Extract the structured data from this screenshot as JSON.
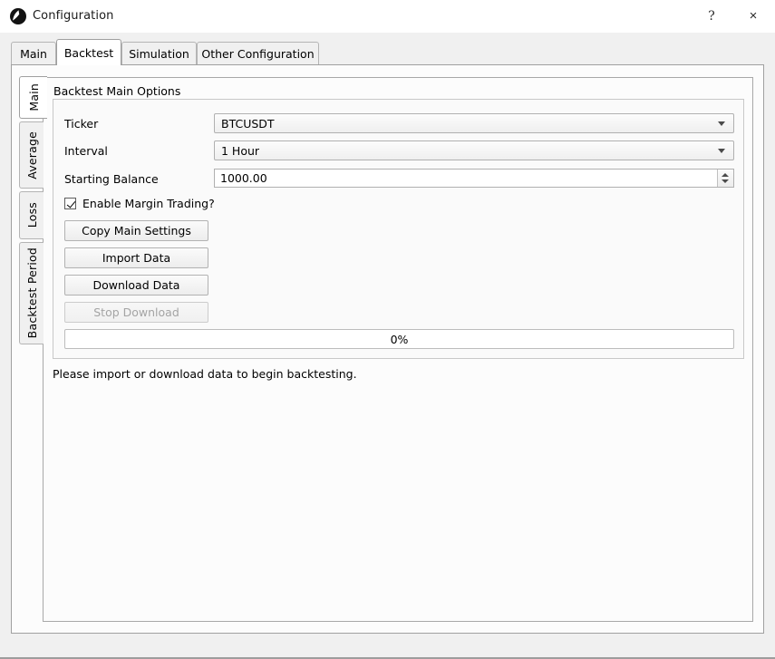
{
  "window": {
    "title": "Configuration",
    "icon": "app-logo-icon",
    "help_label": "?",
    "close_label": "×"
  },
  "tabs": {
    "items": [
      {
        "label": "Main",
        "selected": false
      },
      {
        "label": "Backtest",
        "selected": true
      },
      {
        "label": "Simulation",
        "selected": false
      },
      {
        "label": "Other Configuration",
        "selected": false
      }
    ]
  },
  "side_tabs": {
    "items": [
      {
        "label": "Main",
        "selected": true
      },
      {
        "label": "Average",
        "selected": false
      },
      {
        "label": "Loss",
        "selected": false
      },
      {
        "label": "Backtest Period",
        "selected": false
      }
    ]
  },
  "group": {
    "title": "Backtest Main Options",
    "fields": {
      "ticker": {
        "label": "Ticker",
        "value": "BTCUSDT",
        "type": "combobox"
      },
      "interval": {
        "label": "Interval",
        "value": "1 Hour",
        "type": "combobox"
      },
      "starting_balance": {
        "label": "Starting Balance",
        "value": "1000.00",
        "type": "spinbox"
      }
    },
    "checkbox": {
      "label": "Enable Margin Trading?",
      "checked": true
    },
    "buttons": [
      {
        "label": "Copy Main Settings",
        "enabled": true
      },
      {
        "label": "Import Data",
        "enabled": true
      },
      {
        "label": "Download Data",
        "enabled": true
      },
      {
        "label": "Stop Download",
        "enabled": false
      }
    ],
    "progress": {
      "text": "0%",
      "percent": 0
    }
  },
  "status": {
    "message": "Please import or download data to begin backtesting."
  },
  "colors": {
    "window_bg": "#f0f0f0",
    "pane_bg": "#fcfcfc",
    "accent": "#4fa3e3",
    "border": "#b4b4b4",
    "disabled_text": "#a4a4a4"
  }
}
